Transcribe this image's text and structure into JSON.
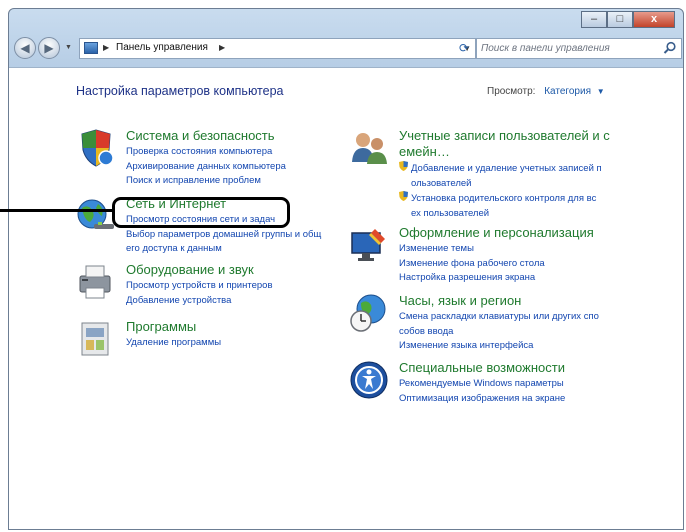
{
  "window": {
    "minimize_glyph": "–",
    "maximize_glyph": "□",
    "close_glyph": "x"
  },
  "address_bar": {
    "back_glyph": "◀",
    "forward_glyph": "▶",
    "path": "Панель управления",
    "separator_glyph": "▶",
    "dropdown_glyph": "▼",
    "refresh_glyph": "⟳"
  },
  "search": {
    "placeholder": "Поиск в панели управления"
  },
  "header": {
    "title": "Настройка параметров компьютера",
    "view_label": "Просмотр:",
    "view_value": "Категория",
    "view_arrow": "▼"
  },
  "categories_left": [
    {
      "title": "Система и безопасность",
      "icon": "shield-icon",
      "links": [
        "Проверка состояния компьютера",
        "Архивирование данных компьютера",
        "Поиск и исправление проблем"
      ]
    },
    {
      "title": "Сеть и Интернет",
      "icon": "globe-network-icon",
      "links": [
        "Просмотр состояния сети и задач",
        "Выбор параметров домашней группы и общ",
        "его доступа к данным"
      ]
    },
    {
      "title": "Оборудование и звук",
      "icon": "printer-icon",
      "links": [
        "Просмотр устройств и принтеров",
        "Добавление устройства"
      ]
    },
    {
      "title": "Программы",
      "icon": "programs-icon",
      "links": [
        "Удаление программы"
      ]
    }
  ],
  "categories_right": [
    {
      "title_line1": "Учетные записи пользователей и с",
      "title_line2": "емейн…",
      "icon": "users-icon",
      "links": [
        "Добавление и удаление учетных записей п",
        "ользователей",
        "Установка родительского контроля для вс",
        "ех пользователей"
      ]
    },
    {
      "title": "Оформление и персонализация",
      "icon": "monitor-paint-icon",
      "links": [
        "Изменение темы",
        "Изменение фона рабочего стола",
        "Настройка разрешения экрана"
      ]
    },
    {
      "title": "Часы, язык и регион",
      "icon": "clock-globe-icon",
      "links": [
        "Смена раскладки клавиатуры или других спо",
        "собов ввода",
        "Изменение языка интерфейса"
      ]
    },
    {
      "title": "Специальные возможности",
      "icon": "accessibility-icon",
      "links": [
        "Рекомендуемые Windows параметры",
        "Оптимизация изображения на экране"
      ]
    }
  ],
  "colors": {
    "category_title": "#1f7a2e",
    "link": "#1447b0",
    "page_title": "#1e3287",
    "frame": "#b6cde5"
  }
}
